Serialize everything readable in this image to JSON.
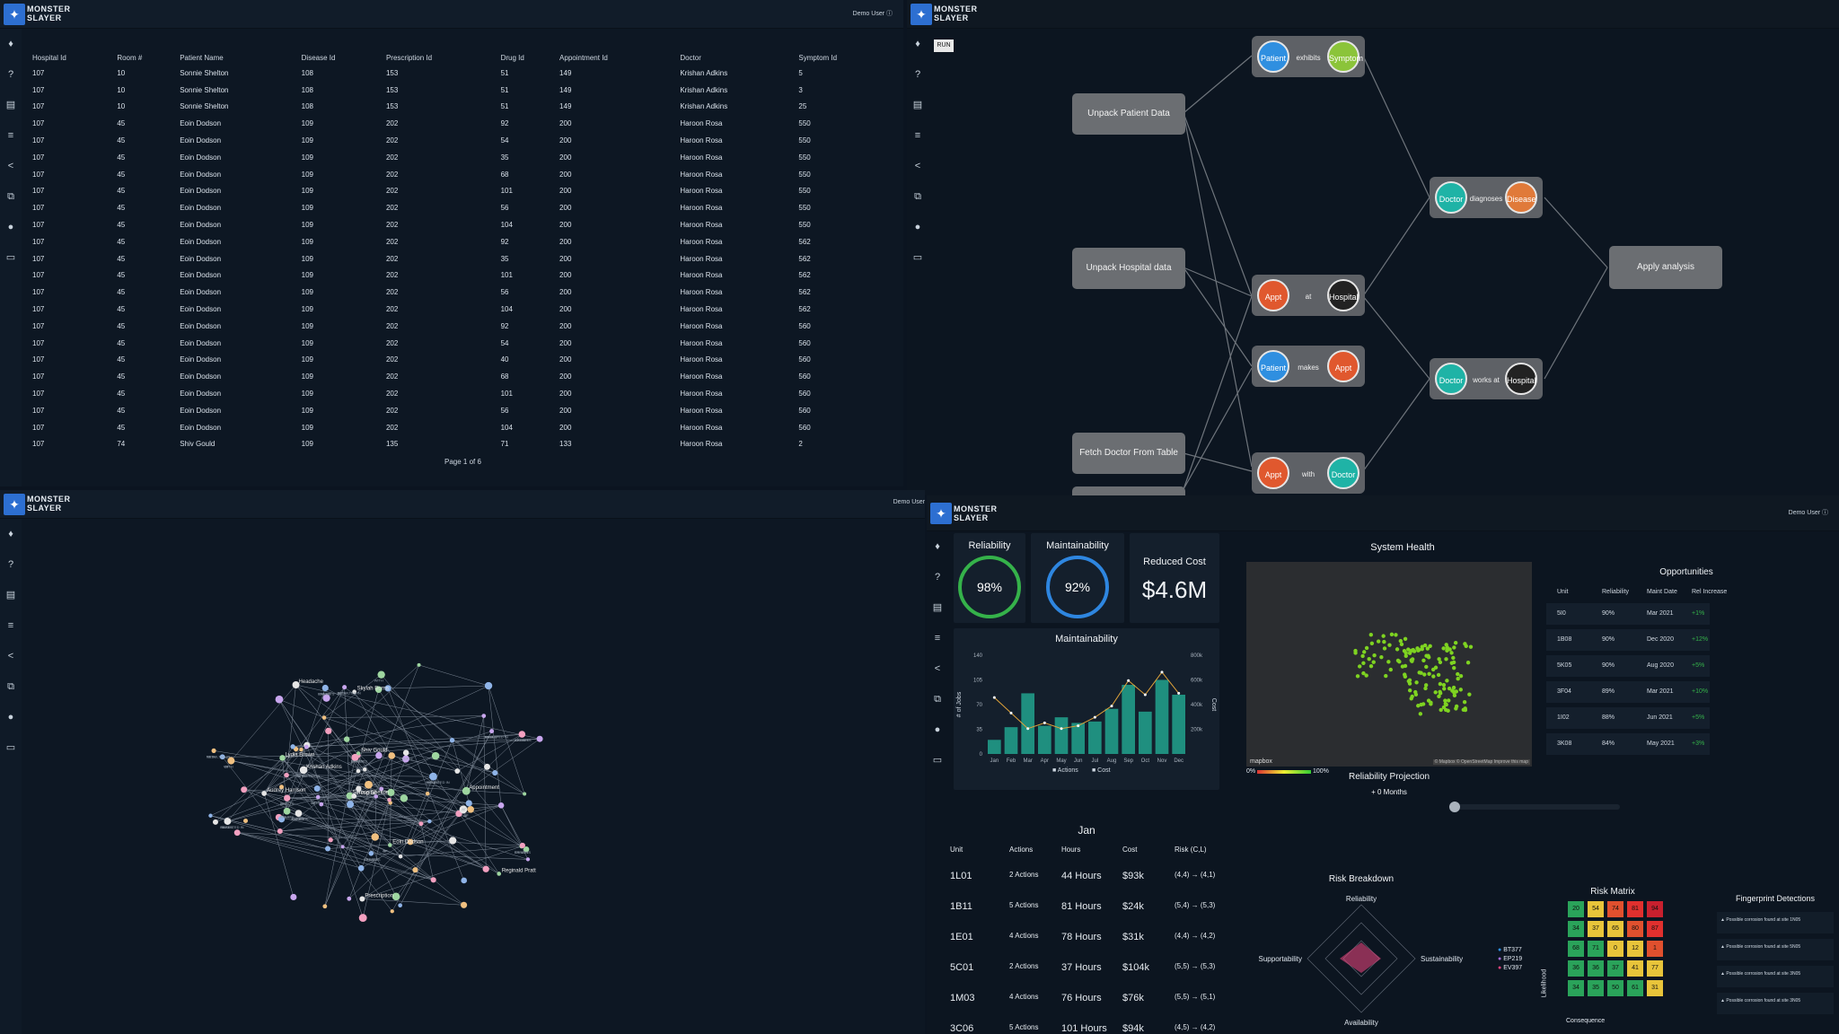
{
  "app": {
    "logo_line1": "MONSTER",
    "logo_line2": "SLAYER",
    "user": "Demo User"
  },
  "sidebar_icons": [
    "bulb-icon",
    "help-icon",
    "doc-icon",
    "list-icon",
    "share-icon",
    "flow-icon",
    "pin-icon",
    "monitor-icon"
  ],
  "patient_table": {
    "columns": [
      "Hospital Id",
      "Room #",
      "Patient Name",
      "Disease Id",
      "Prescription Id",
      "Drug Id",
      "Appointment Id",
      "Doctor",
      "Symptom Id"
    ],
    "rows": [
      [
        "107",
        "10",
        "Sonnie Shelton",
        "108",
        "153",
        "51",
        "149",
        "Krishan Adkins",
        "5"
      ],
      [
        "107",
        "10",
        "Sonnie Shelton",
        "108",
        "153",
        "51",
        "149",
        "Krishan Adkins",
        "3"
      ],
      [
        "107",
        "10",
        "Sonnie Shelton",
        "108",
        "153",
        "51",
        "149",
        "Krishan Adkins",
        "25"
      ],
      [
        "107",
        "45",
        "Eoin Dodson",
        "109",
        "202",
        "92",
        "200",
        "Haroon Rosa",
        "550"
      ],
      [
        "107",
        "45",
        "Eoin Dodson",
        "109",
        "202",
        "54",
        "200",
        "Haroon Rosa",
        "550"
      ],
      [
        "107",
        "45",
        "Eoin Dodson",
        "109",
        "202",
        "35",
        "200",
        "Haroon Rosa",
        "550"
      ],
      [
        "107",
        "45",
        "Eoin Dodson",
        "109",
        "202",
        "68",
        "200",
        "Haroon Rosa",
        "550"
      ],
      [
        "107",
        "45",
        "Eoin Dodson",
        "109",
        "202",
        "101",
        "200",
        "Haroon Rosa",
        "550"
      ],
      [
        "107",
        "45",
        "Eoin Dodson",
        "109",
        "202",
        "56",
        "200",
        "Haroon Rosa",
        "550"
      ],
      [
        "107",
        "45",
        "Eoin Dodson",
        "109",
        "202",
        "104",
        "200",
        "Haroon Rosa",
        "550"
      ],
      [
        "107",
        "45",
        "Eoin Dodson",
        "109",
        "202",
        "92",
        "200",
        "Haroon Rosa",
        "562"
      ],
      [
        "107",
        "45",
        "Eoin Dodson",
        "109",
        "202",
        "35",
        "200",
        "Haroon Rosa",
        "562"
      ],
      [
        "107",
        "45",
        "Eoin Dodson",
        "109",
        "202",
        "101",
        "200",
        "Haroon Rosa",
        "562"
      ],
      [
        "107",
        "45",
        "Eoin Dodson",
        "109",
        "202",
        "56",
        "200",
        "Haroon Rosa",
        "562"
      ],
      [
        "107",
        "45",
        "Eoin Dodson",
        "109",
        "202",
        "104",
        "200",
        "Haroon Rosa",
        "562"
      ],
      [
        "107",
        "45",
        "Eoin Dodson",
        "109",
        "202",
        "92",
        "200",
        "Haroon Rosa",
        "560"
      ],
      [
        "107",
        "45",
        "Eoin Dodson",
        "109",
        "202",
        "54",
        "200",
        "Haroon Rosa",
        "560"
      ],
      [
        "107",
        "45",
        "Eoin Dodson",
        "109",
        "202",
        "40",
        "200",
        "Haroon Rosa",
        "560"
      ],
      [
        "107",
        "45",
        "Eoin Dodson",
        "109",
        "202",
        "68",
        "200",
        "Haroon Rosa",
        "560"
      ],
      [
        "107",
        "45",
        "Eoin Dodson",
        "109",
        "202",
        "101",
        "200",
        "Haroon Rosa",
        "560"
      ],
      [
        "107",
        "45",
        "Eoin Dodson",
        "109",
        "202",
        "56",
        "200",
        "Haroon Rosa",
        "560"
      ],
      [
        "107",
        "45",
        "Eoin Dodson",
        "109",
        "202",
        "104",
        "200",
        "Haroon Rosa",
        "560"
      ],
      [
        "107",
        "74",
        "Shiv Gould",
        "109",
        "135",
        "71",
        "133",
        "Haroon Rosa",
        "2"
      ]
    ],
    "pager": "Page 1 of 6"
  },
  "flow": {
    "run_label": "RUN",
    "boxes": [
      "Unpack Patient Data",
      "Unpack Hospital data",
      "Fetch Doctor From Table",
      "Apply analysis"
    ],
    "pairs": [
      {
        "a": "Patient",
        "rel": "exhibits",
        "b": "Symptom",
        "ca": "#2f8fe0",
        "cb": "#8bc43a"
      },
      {
        "a": "Doctor",
        "rel": "diagnoses",
        "b": "Disease",
        "ca": "#1fb3a6",
        "cb": "#e07a3a"
      },
      {
        "a": "Appt",
        "rel": "at",
        "b": "Hospital",
        "ca": "#e0582e",
        "cb": "#222"
      },
      {
        "a": "Patient",
        "rel": "makes",
        "b": "Appt",
        "ca": "#2f8fe0",
        "cb": "#e0582e"
      },
      {
        "a": "Doctor",
        "rel": "works at",
        "b": "Hospital",
        "ca": "#1fb3a6",
        "cb": "#222"
      },
      {
        "a": "Appt",
        "rel": "with",
        "b": "Doctor",
        "ca": "#e0582e",
        "cb": "#1fb3a6"
      }
    ]
  },
  "graph": {
    "labels": [
      "Audrey Harrison",
      "Lydia Brown",
      "Krishan Adkins",
      "Sonnie Shelton",
      "Prescription",
      "Appointment",
      "Headache",
      "Eoin Dodson",
      "Skylah Burns",
      "Reginald Pratt",
      "Hospital",
      "Shiv Gould"
    ],
    "edge_labels": [
      "TREATS",
      "EXHIBITS",
      "MAKES",
      "RESULTED IN",
      "WITH",
      "OF",
      "AT"
    ]
  },
  "dashboard": {
    "reliability": {
      "title": "Reliability",
      "value": "98%"
    },
    "maintainability": {
      "title": "Maintainability",
      "value": "92%"
    },
    "reduced_cost": {
      "title": "Reduced Cost",
      "value": "$4.6M"
    },
    "chart_title": "Maintainability",
    "month": "Jan",
    "table_cols": [
      "Unit",
      "Actions",
      "Hours",
      "Cost",
      "Risk (C,L)"
    ],
    "table_rows": [
      [
        "1L01",
        "2 Actions",
        "44 Hours",
        "$93k",
        "(4,4) → (4,1)"
      ],
      [
        "1B11",
        "5 Actions",
        "81 Hours",
        "$24k",
        "(5,4) → (5,3)"
      ],
      [
        "1E01",
        "4 Actions",
        "78 Hours",
        "$31k",
        "(4,4) → (4,2)"
      ],
      [
        "5C01",
        "2 Actions",
        "37 Hours",
        "$104k",
        "(5,5) → (5,3)"
      ],
      [
        "1M03",
        "4 Actions",
        "76 Hours",
        "$76k",
        "(5,5) → (5,1)"
      ],
      [
        "3C06",
        "5 Actions",
        "101 Hours",
        "$94k",
        "(4,5) → (4,2)"
      ]
    ],
    "system_health": "System Health",
    "map_attrib": "mapbox",
    "map_credit": "© Mapbox © OpenStreetMap Improve this map",
    "scale_min": "0%",
    "scale_max": "100%",
    "projection_title": "Reliability Projection",
    "projection_value": "+ 0 Months",
    "opportunities": {
      "title": "Opportunities",
      "cols": [
        "Unit",
        "Reliability",
        "Maint Date",
        "Rel Increase"
      ],
      "rows": [
        [
          "5I0",
          "90%",
          "Mar 2021",
          "+1%"
        ],
        [
          "1B08",
          "90%",
          "Dec 2020",
          "+12%"
        ],
        [
          "5K05",
          "90%",
          "Aug 2020",
          "+5%"
        ],
        [
          "3F04",
          "89%",
          "Mar 2021",
          "+10%"
        ],
        [
          "1I02",
          "88%",
          "Jun 2021",
          "+5%"
        ],
        [
          "3K08",
          "84%",
          "May 2021",
          "+3%"
        ]
      ]
    },
    "risk_breakdown": {
      "title": "Risk Breakdown",
      "axes": [
        "Reliability",
        "Sustainability",
        "Availability",
        "Supportability"
      ],
      "legend": [
        "BT377",
        "EP219",
        "EV397"
      ]
    },
    "risk_matrix": {
      "title": "Risk Matrix",
      "ylabel": "Likelihood",
      "xlabel": "Consequence",
      "cells": [
        [
          "20",
          "54",
          "74",
          "81",
          "94"
        ],
        [
          "34",
          "37",
          "65",
          "80",
          "87"
        ],
        [
          "68",
          "71",
          "0",
          "12",
          "1"
        ],
        [
          "36",
          "36",
          "37",
          "41",
          "77"
        ],
        [
          "34",
          "35",
          "50",
          "61",
          "31"
        ]
      ]
    },
    "fingerprint": {
      "title": "Fingerprint Detections",
      "items": [
        "Possible corrosion found at site 1N05",
        "Possible corrosion found at site 5N05",
        "Possible corrosion found at site 3N05",
        "Possible corrosion found at site 3N05"
      ]
    }
  },
  "chart_data": {
    "type": "bar",
    "title": "Maintainability",
    "categories": [
      "Jan",
      "Feb",
      "Mar",
      "Apr",
      "May",
      "Jun",
      "Jul",
      "Aug",
      "Sep",
      "Oct",
      "Nov",
      "Dec"
    ],
    "series": [
      {
        "name": "Actions",
        "values": [
          20,
          38,
          86,
          40,
          52,
          44,
          46,
          64,
          98,
          60,
          105,
          84
        ]
      },
      {
        "name": "Cost",
        "values": [
          400,
          290,
          180,
          220,
          180,
          200,
          260,
          340,
          520,
          420,
          580,
          430
        ]
      }
    ],
    "ylabel": "# of Jobs",
    "y2label": "Cost",
    "ylim": [
      0,
      140
    ],
    "y2lim": [
      0,
      700
    ],
    "yticks": [
      0,
      35,
      70,
      105,
      140
    ],
    "y2ticks": [
      "200k",
      "400k",
      "600k",
      "800k"
    ],
    "colors": {
      "Actions": "#1f8f7f",
      "Cost": "#e0a33a"
    }
  }
}
